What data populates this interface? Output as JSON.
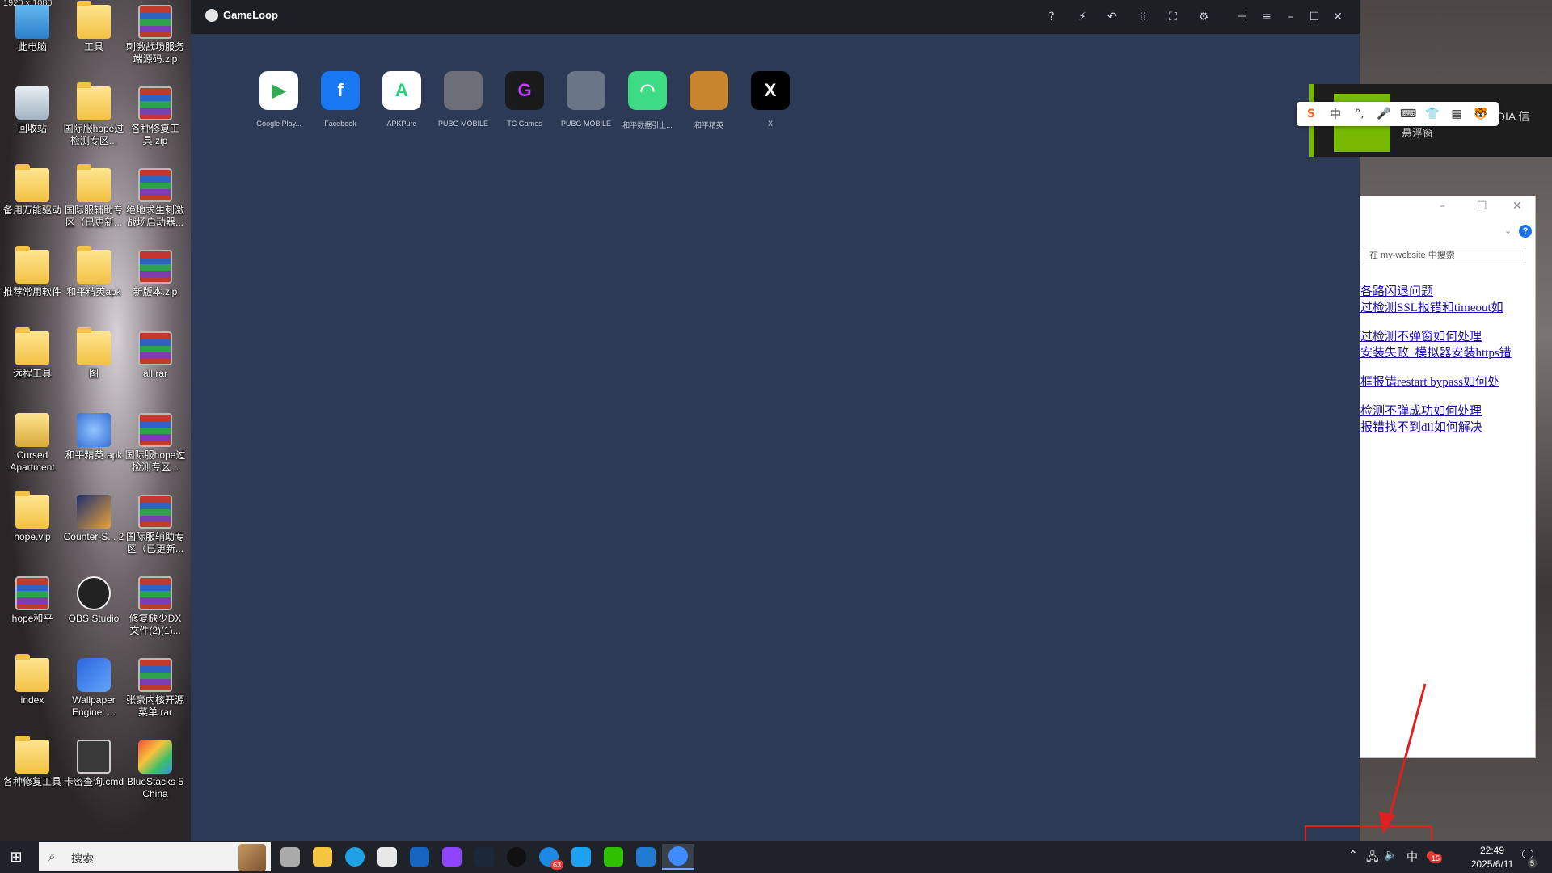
{
  "resolution_label": "1920 x 1080",
  "desktop": {
    "icons": [
      {
        "label": "此电脑",
        "kind": "pc"
      },
      {
        "label": "工具",
        "kind": "folder"
      },
      {
        "label": "刺激战场服务端源码.zip",
        "kind": "rar"
      },
      {
        "label": "回收站",
        "kind": "bin"
      },
      {
        "label": "国际服hope过检测专区...",
        "kind": "folder"
      },
      {
        "label": "各种修复工具.zip",
        "kind": "rar"
      },
      {
        "label": "备用万能驱动",
        "kind": "folder"
      },
      {
        "label": "国际服辅助专区（已更新...",
        "kind": "folder"
      },
      {
        "label": "绝地求生刺激战场启动器...",
        "kind": "rar"
      },
      {
        "label": "推荐常用软件",
        "kind": "folder"
      },
      {
        "label": "和平精英apk",
        "kind": "folder"
      },
      {
        "label": "新版本.zip",
        "kind": "rar"
      },
      {
        "label": "远程工具",
        "kind": "folder"
      },
      {
        "label": "图",
        "kind": "folder"
      },
      {
        "label": "all.rar",
        "kind": "rar"
      },
      {
        "label": "Cursed Apartment",
        "kind": "cursed"
      },
      {
        "label": "和平精英.apk",
        "kind": "blue"
      },
      {
        "label": "国际服hope过检测专区...",
        "kind": "rar"
      },
      {
        "label": "hope.vip",
        "kind": "folder"
      },
      {
        "label": "Counter-S... 2",
        "kind": "cs"
      },
      {
        "label": "国际服辅助专区（已更新...",
        "kind": "rar"
      },
      {
        "label": "hope和平",
        "kind": "rar"
      },
      {
        "label": "OBS Studio",
        "kind": "dark"
      },
      {
        "label": "修复缺少DX文件(2)(1)...",
        "kind": "rar"
      },
      {
        "label": "index",
        "kind": "folder"
      },
      {
        "label": "Wallpaper Engine: ...",
        "kind": "wall"
      },
      {
        "label": "张豪内核开源菜单.rar",
        "kind": "rar"
      },
      {
        "label": "各种修复工具",
        "kind": "folder"
      },
      {
        "label": "卡密查询.cmd",
        "kind": "cmd"
      },
      {
        "label": "BlueStacks 5 China",
        "kind": "bs"
      }
    ]
  },
  "gameloop": {
    "title": "GameLoop",
    "toolbar_icons": [
      "help-icon",
      "boost-icon",
      "undo-icon",
      "keyboard-icon",
      "fullscreen-icon",
      "settings-icon",
      "pin-icon",
      "menu-icon",
      "minimize-icon",
      "maximize-icon",
      "close-icon"
    ],
    "apps": [
      {
        "label": "Google Play...",
        "color": "#ffffff",
        "glyph": "▶",
        "fg": "#34a853"
      },
      {
        "label": "Facebook",
        "color": "#1877f2",
        "glyph": "f",
        "fg": "#ffffff"
      },
      {
        "label": "APKPure",
        "color": "#ffffff",
        "glyph": "A",
        "fg": "#24cd77"
      },
      {
        "label": "PUBG MOBILE",
        "color": "#6b6f78",
        "glyph": "",
        "fg": "#ffffff"
      },
      {
        "label": "TC Games",
        "color": "#1a1a1a",
        "glyph": "G",
        "fg": "#c040ff"
      },
      {
        "label": "PUBG MOBILE",
        "color": "#6a7587",
        "glyph": "",
        "fg": "#ffffff"
      },
      {
        "label": "和平数据引上...",
        "color": "#3ddc84",
        "glyph": "◠",
        "fg": "#ffffff"
      },
      {
        "label": "和平精英",
        "color": "#c9852c",
        "glyph": "",
        "fg": "#ffffff"
      },
      {
        "label": "X",
        "color": "#000000",
        "glyph": "X",
        "fg": "#ffffff"
      }
    ]
  },
  "nvidia": {
    "overlay_text": "悬浮窗",
    "label": "IDIA 信"
  },
  "ime": {
    "items": [
      "S",
      "中",
      "°,",
      "🎤",
      "⌨",
      "👕",
      "▦",
      "🐯"
    ]
  },
  "browser": {
    "search_placeholder": "在 my-website 中搜索",
    "links": [
      "各路闪退问题",
      "过检测SSL报错和timeout如",
      "过检测不弹窗如何处理",
      "安装失败_模拟器安装https错",
      "框报错restart bypass如何处",
      "检测不弹成功如何处理",
      "报错找不到dll如何解决"
    ]
  },
  "taskbar": {
    "search_placeholder": "搜索",
    "apps": [
      "task-view",
      "file-explorer",
      "edge",
      "store",
      "outlook",
      "app-purple",
      "steam",
      "qq",
      "app-blue",
      "app-teal",
      "wechat",
      "vscode",
      "gameloop"
    ],
    "app_badge": "63",
    "ime_indicator": "中",
    "tray_badge": "15",
    "time": "22:49",
    "date": "2025/6/11",
    "notifications": "5"
  }
}
